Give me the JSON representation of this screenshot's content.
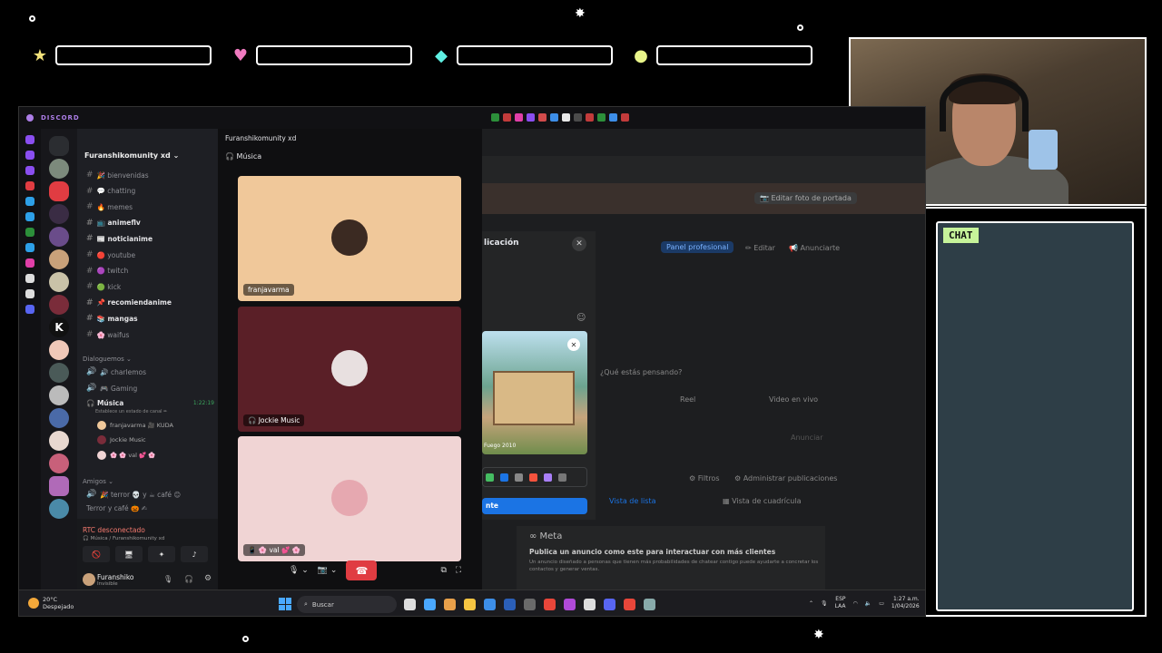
{
  "overlay": {
    "chat_label": "CHAT",
    "hud_icons": [
      "star-icon",
      "heart-icon",
      "diamond-icon",
      "orb-icon"
    ]
  },
  "discord": {
    "app_title": "DISCORD",
    "server_name": "Furanshikomunity xd",
    "window_title": "Furanshikomunity xd",
    "voice_channel_header": "🎧 Música",
    "channels": [
      {
        "name": "🎉 bienvenidas",
        "bold": false
      },
      {
        "name": "💬 chatting",
        "bold": false
      },
      {
        "name": "🔥 memes",
        "bold": false
      },
      {
        "name": "📺 animeflv",
        "bold": true
      },
      {
        "name": "📰 noticianime",
        "bold": true
      },
      {
        "name": "🔴 youtube",
        "bold": false
      },
      {
        "name": "🟣 twitch",
        "bold": false
      },
      {
        "name": "🟢 kick",
        "bold": false
      },
      {
        "name": "📌 recomiendanime",
        "bold": true
      },
      {
        "name": "📚 mangas",
        "bold": true
      },
      {
        "name": "🌸 waifus",
        "bold": false
      }
    ],
    "category_dialogues": "Dialoguemos",
    "voice_channels": [
      {
        "name": "🔊 charlemos"
      },
      {
        "name": "🎮 Gaming"
      }
    ],
    "active_voice": {
      "name": "🎧 Música",
      "timer": "1:22:19",
      "status_hint": "Establece un estado de canal ✏",
      "members": [
        "franjavarma 🎥 KUDA",
        "Jockie Music",
        "🌸 🌸 val 💕 🌸"
      ]
    },
    "category_friends": "Amigos",
    "friends_channels": [
      "🎉 terror 💀 y ☕ café 😊",
      "Terror y café 🎃 ✍"
    ],
    "rtc": {
      "title": "RTC desconectado",
      "subtitle": "🎧 Música / Furanshikomunity xd"
    },
    "user": {
      "name": "Furanshiko",
      "status": "Invisible"
    },
    "tiles": [
      {
        "name": "franjavarma",
        "bg": "#f0c89a"
      },
      {
        "name": "🎧 Jockie Music",
        "bg": "#5a1f27"
      },
      {
        "name": "📱 🌸 val 💕 🌸",
        "bg": "#f0d4d4"
      }
    ]
  },
  "facebook": {
    "modal_title": "licación",
    "image_caption": "Fuego 2010",
    "submit_label": "nte",
    "edit_cover": "📷 Editar foto de portada",
    "panel_btn": "Panel profesional",
    "edit_btn": "✏ Editar",
    "ad_btn": "📢 Anunciarte",
    "placeholder": "¿Qué estás pensando?",
    "reel": "Reel",
    "live": "Video en vivo",
    "filters": "⚙ Filtros",
    "manage": "⚙ Administrar publicaciones",
    "list_view": "Vista de lista",
    "grid_view": "▦ Vista de cuadrícula",
    "meta_logo": "∞ Meta",
    "meta_title": "Publica un anuncio como este para interactuar con más clientes",
    "meta_desc": "Un anuncio diseñado a personas que tienen más probabilidades de chatear contigo puede ayudarte a concretar los contactos y generar ventas.",
    "ad_hint": "Anunciar"
  },
  "taskbar": {
    "temp": "20°C",
    "weather": "Despejado",
    "search": "Buscar",
    "lang": "ESP",
    "layout": "LAA",
    "time": "1:27 a.m.",
    "date": "1/04/2026"
  },
  "colors": {
    "discord_accent": "#5865f2",
    "hangup": "#e03c42",
    "fb_blue": "#1b74e4",
    "rtc_red": "#f57a6f"
  }
}
